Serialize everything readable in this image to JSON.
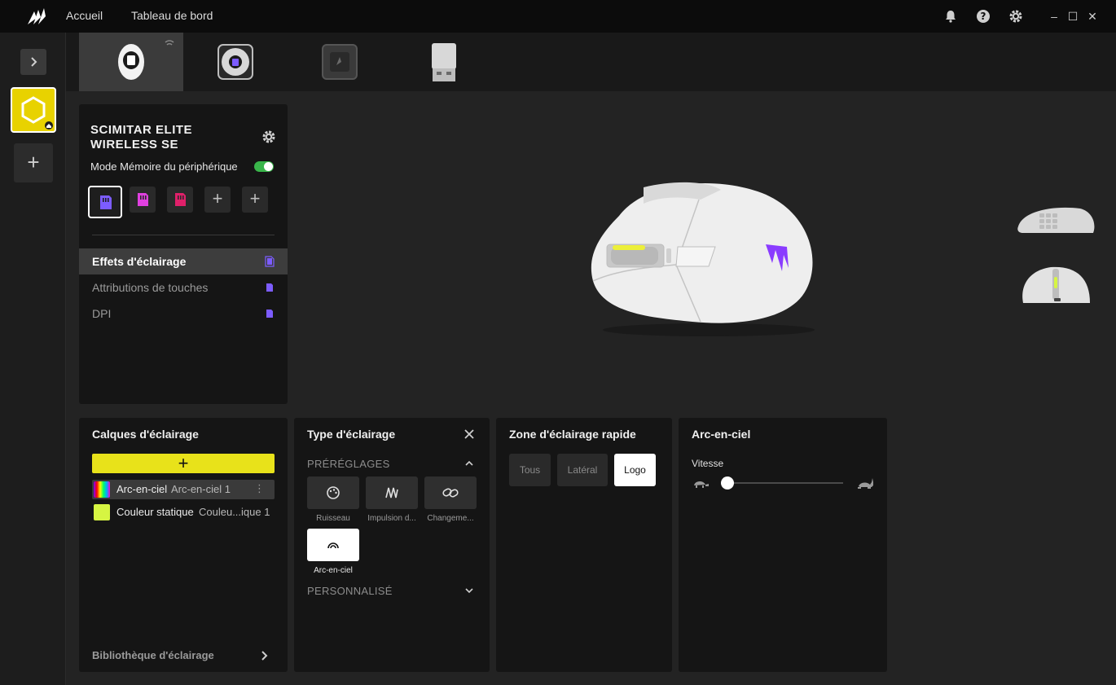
{
  "titlebar": {
    "nav": [
      "Accueil",
      "Tableau de bord"
    ],
    "icons": [
      "bell-icon",
      "help-icon",
      "gear-icon"
    ],
    "window_controls": [
      "minimize",
      "maximize",
      "close"
    ]
  },
  "rail": {
    "expand_icon": "chevron-right-icon",
    "profile_color": "#e8d200",
    "add_icon": "plus-icon"
  },
  "devices": [
    {
      "name": "mouse",
      "active": true
    },
    {
      "name": "fan",
      "active": false
    },
    {
      "name": "hub",
      "active": false
    },
    {
      "name": "wireless-dongle",
      "active": false
    }
  ],
  "device_panel": {
    "title": "SCIMITAR ELITE WIRELESS SE",
    "memory_mode_label": "Mode Mémoire du périphérique",
    "memory_mode_on": true,
    "slots": [
      {
        "color": "#7c5cff",
        "selected": true
      },
      {
        "color": "#e040e0",
        "selected": false
      },
      {
        "color": "#e0206a",
        "selected": false
      },
      {
        "add": true
      },
      {
        "add": true
      }
    ],
    "menu": [
      {
        "label": "Effets d'éclairage",
        "active": true
      },
      {
        "label": "Attributions de touches",
        "active": false
      },
      {
        "label": "DPI",
        "active": false
      }
    ]
  },
  "layers_panel": {
    "title": "Calques d'éclairage",
    "add_label": "+",
    "layers": [
      {
        "name": "Arc-en-ciel",
        "sub": "Arc-en-ciel 1",
        "selected": true
      },
      {
        "name": "Couleur statique",
        "sub": "Couleu...ique 1",
        "selected": false,
        "color": "#d6f542"
      }
    ],
    "library_label": "Bibliothèque d'éclairage"
  },
  "lighting_type_panel": {
    "title": "Type d'éclairage",
    "presets_header": "PRÉRÉGLAGES",
    "custom_header": "PERSONNALISÉ",
    "presets": [
      {
        "label": "Ruisseau",
        "icon": "palette-icon",
        "selected": false
      },
      {
        "label": "Impulsion d...",
        "icon": "pulse-icon",
        "selected": false
      },
      {
        "label": "Changeme...",
        "icon": "link-icon",
        "selected": false
      },
      {
        "label": "Arc-en-ciel",
        "icon": "rainbow-icon",
        "selected": true
      }
    ]
  },
  "zone_panel": {
    "title": "Zone d'éclairage rapide",
    "zones": [
      {
        "label": "Tous",
        "selected": false
      },
      {
        "label": "Latéral",
        "selected": false
      },
      {
        "label": "Logo",
        "selected": true
      }
    ]
  },
  "rainbow_panel": {
    "title": "Arc-en-ciel",
    "speed_label": "Vitesse",
    "speed_value": 0.0,
    "slow_icon": "turtle-icon",
    "fast_icon": "rabbit-icon"
  }
}
